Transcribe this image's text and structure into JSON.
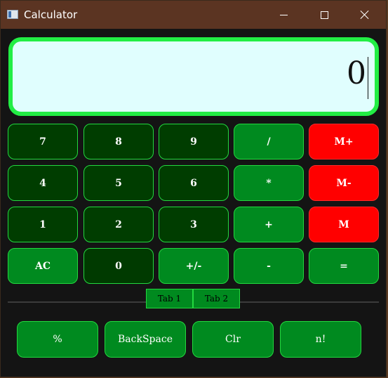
{
  "window": {
    "title": "Calculator",
    "icon": "app-window-icon",
    "controls": {
      "minimize_icon": "minimize-icon",
      "maximize_icon": "maximize-icon",
      "close_icon": "close-icon"
    }
  },
  "display": {
    "value": "0"
  },
  "keypad": {
    "rows": [
      [
        "7",
        "8",
        "9",
        "/",
        "M+"
      ],
      [
        "4",
        "5",
        "6",
        "*",
        "M-"
      ],
      [
        "1",
        "2",
        "3",
        "+",
        "M"
      ],
      [
        "AC",
        "0",
        "+/-",
        "-",
        "="
      ]
    ]
  },
  "tabs": [
    {
      "label": "Tab 1"
    },
    {
      "label": "Tab 2"
    }
  ],
  "extra_keys": [
    "%",
    "BackSpace",
    "Clr",
    "n!"
  ],
  "colors": {
    "title_bar": "#5b3422",
    "background": "#141414",
    "display_border": "#22ee44",
    "display_bg": "#e0fefe",
    "digit_key": "#003d00",
    "op_key": "#008a1f",
    "memory_key": "#ff0000"
  }
}
